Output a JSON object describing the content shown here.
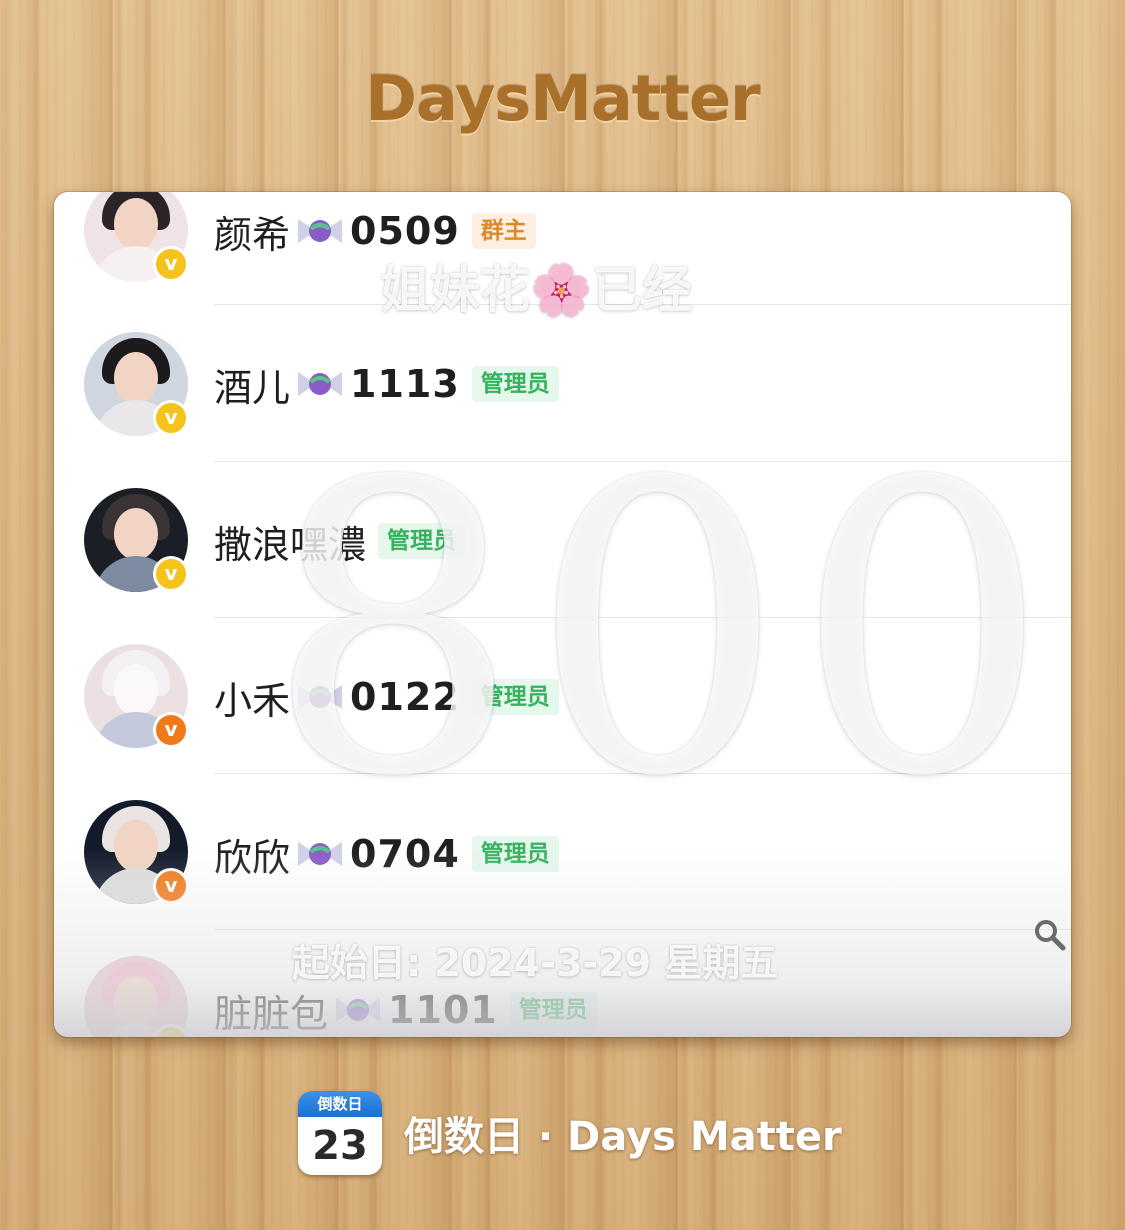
{
  "app": {
    "title": "DaysMatter"
  },
  "event": {
    "name": "姐妹花🌸已经",
    "days": "800",
    "start_date": "起始日: 2024-3-29 星期五"
  },
  "members": [
    {
      "name": "颜希",
      "number": "0509",
      "role": "群主",
      "badge_color": "#f5c31c"
    },
    {
      "name": "酒儿",
      "number": "1113",
      "role": "管理员",
      "badge_color": "#f5c31c"
    },
    {
      "name": "撒浪嘿濃",
      "number": "",
      "role": "管理员",
      "badge_color": "#f5c31c"
    },
    {
      "name": "小禾",
      "number": "0122",
      "role": "管理员",
      "badge_color": "#f07a1a"
    },
    {
      "name": "欣欣",
      "number": "0704",
      "role": "管理员",
      "badge_color": "#f07a1a"
    },
    {
      "name": "脏脏包",
      "number": "1101",
      "role": "管理员",
      "badge_color": "#f5c31c"
    }
  ],
  "footer": {
    "calendar_header": "倒数日",
    "calendar_day": "23",
    "label": "倒数日 · Days Matter"
  },
  "icons": {
    "search": "search-icon",
    "candy": "candy-icon",
    "verified": "verified-badge-icon"
  },
  "colors": {
    "owner_tag": "#e0892b",
    "admin_tag": "#36b25f",
    "title": "#a9702b"
  }
}
